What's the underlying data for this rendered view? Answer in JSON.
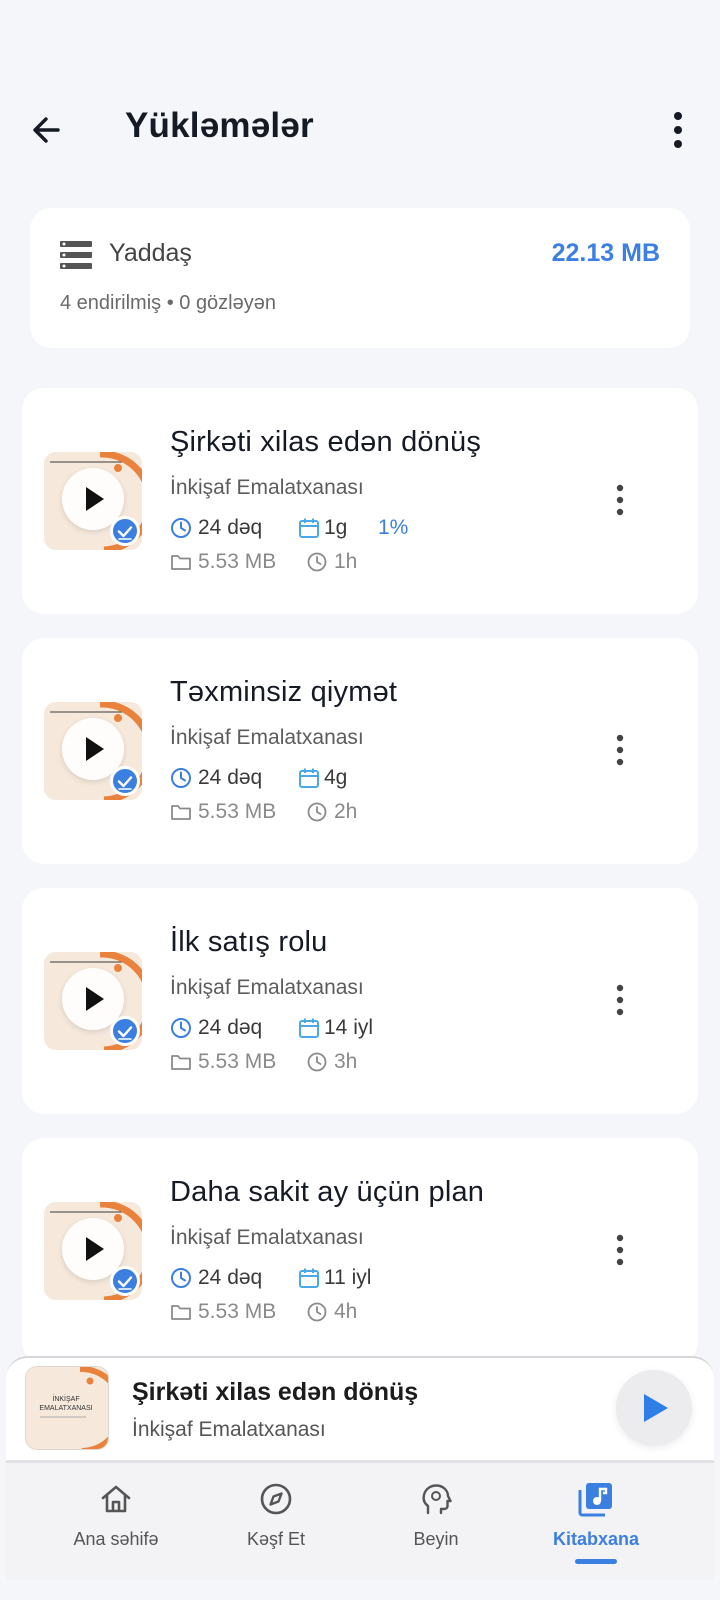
{
  "header": {
    "title": "Yükləmələr",
    "back_icon": "arrow-left-icon",
    "more_icon": "more-vertical-icon"
  },
  "storage": {
    "label": "Yaddaş",
    "size": "22.13 MB",
    "summary": "4 endirilmiş • 0 gözləyən",
    "icon": "storage-icon"
  },
  "downloads": [
    {
      "title": "Şirkəti xilas edən dönüş",
      "author": "İnkişaf Emalatxanası",
      "duration": "24 dəq",
      "date": "1g",
      "progress": "1%",
      "size": "5.53 MB",
      "time_ago": "1h"
    },
    {
      "title": "Təxminsiz qiymət",
      "author": "İnkişaf Emalatxanası",
      "duration": "24 dəq",
      "date": "4g",
      "progress": "",
      "size": "5.53 MB",
      "time_ago": "2h"
    },
    {
      "title": "İlk satış rolu",
      "author": "İnkişaf Emalatxanası",
      "duration": "24 dəq",
      "date": "14 iyl",
      "progress": "",
      "size": "5.53 MB",
      "time_ago": "3h"
    },
    {
      "title": "Daha sakit ay üçün plan",
      "author": "İnkişaf Emalatxanası",
      "duration": "24 dəq",
      "date": "11 iyl",
      "progress": "",
      "size": "5.53 MB",
      "time_ago": "4h"
    }
  ],
  "mini_player": {
    "title": "Şirkəti xilas edən dönüş",
    "author": "İnkişaf Emalatxanası",
    "cover_text": "İNKİŞAF EMALATXANASI"
  },
  "nav": [
    {
      "label": "Ana səhifə",
      "icon": "home-icon"
    },
    {
      "label": "Kəşf Et",
      "icon": "compass-icon"
    },
    {
      "label": "Beyin",
      "icon": "brain-head-icon"
    },
    {
      "label": "Kitabxana",
      "icon": "library-music-icon"
    }
  ],
  "colors": {
    "accent": "#3b7fe0",
    "background": "#f5f6fa",
    "card": "#ffffff",
    "thumb_bg": "#f6e9dc",
    "thumb_orange": "#e8823c"
  }
}
